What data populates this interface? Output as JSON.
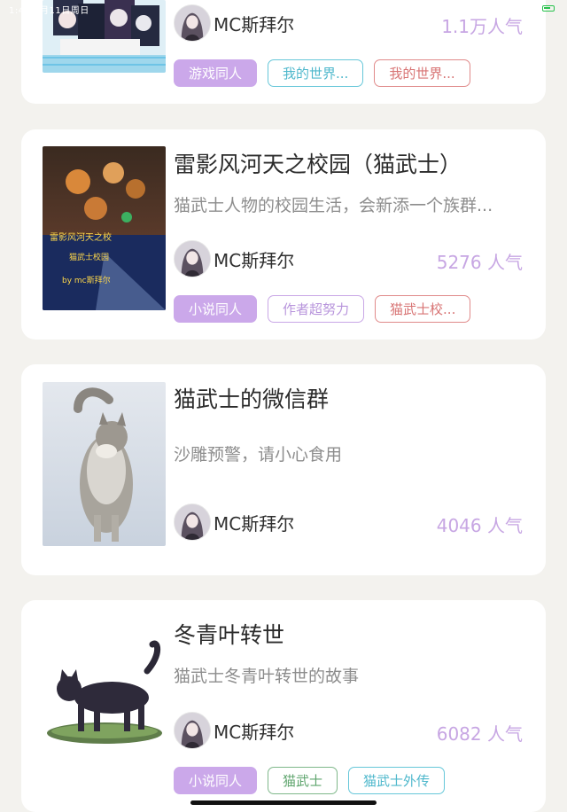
{
  "status_bar": {
    "time": "1:43 5月11日周日"
  },
  "colors": {
    "accent": "#cba8ea",
    "popularity": "#c7a6e3",
    "background": "#f3f2ee",
    "tag_cyan": "#66c7d9",
    "tag_red": "#e08a8a",
    "tag_purple": "#c9a7e6",
    "tag_green": "#7fb88a"
  },
  "cards": [
    {
      "author": "MC斯拜尔",
      "popularity": "1.1万人气",
      "cover_icon": "anime-group-cover",
      "tags": [
        "游戏同人",
        "我的世界...",
        "我的世界..."
      ]
    },
    {
      "title": "雷影风河天之校园（猫武士）",
      "description": "猫武士人物的校园生活，会新添一个族群...",
      "author": "MC斯拜尔",
      "popularity": "5276 人气",
      "cover_icon": "warrior-cats-cover",
      "cover_text": [
        "雷影风河天之校",
        "猫武士校园",
        "by mc斯拜尔"
      ],
      "tags": [
        "小说同人",
        "作者超努力",
        "猫武士校..."
      ]
    },
    {
      "title": "猫武士的微信群",
      "description": "沙雕预警，请小心食用",
      "author": "MC斯拜尔",
      "popularity": "4046 人气",
      "cover_icon": "gray-cat-cover"
    },
    {
      "title": "冬青叶转世",
      "description": "猫武士冬青叶转世的故事",
      "author": "MC斯拜尔",
      "popularity": "6082 人气",
      "cover_icon": "black-cat-cover",
      "tags": [
        "小说同人",
        "猫武士",
        "猫武士外传"
      ]
    }
  ]
}
